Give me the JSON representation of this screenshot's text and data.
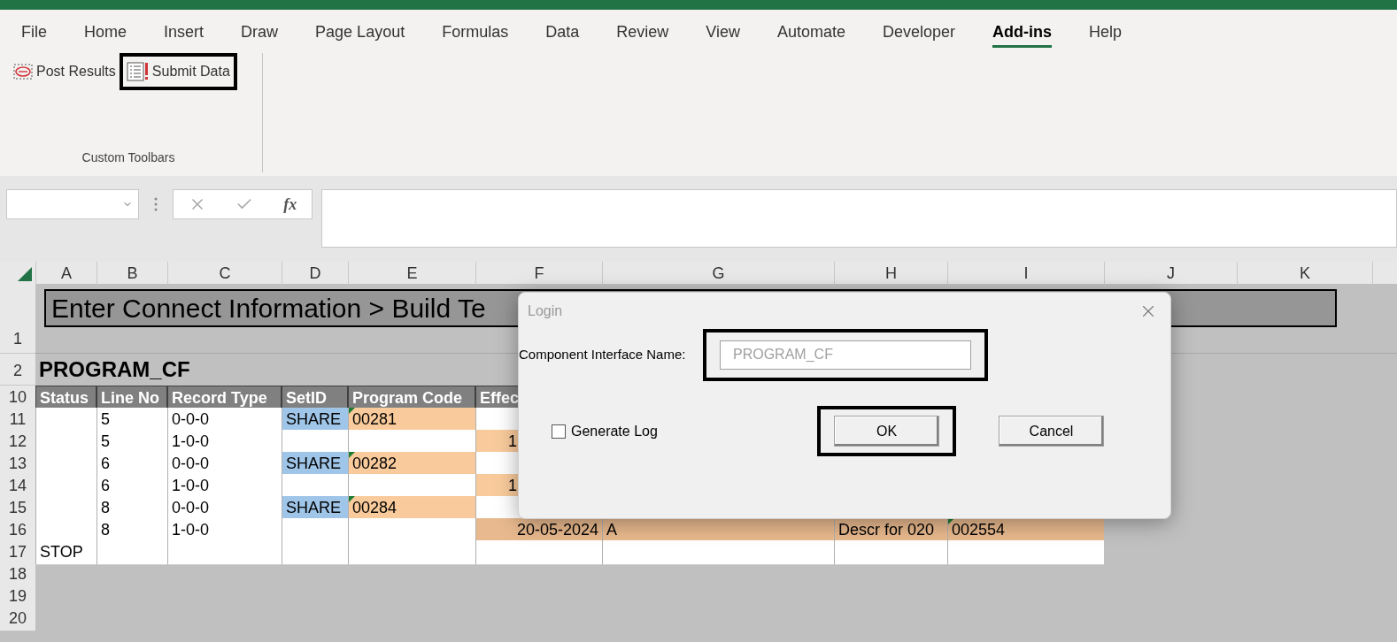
{
  "menu_tabs": [
    {
      "label": "File",
      "selected": false
    },
    {
      "label": "Home",
      "selected": false
    },
    {
      "label": "Insert",
      "selected": false
    },
    {
      "label": "Draw",
      "selected": false
    },
    {
      "label": "Page Layout",
      "selected": false
    },
    {
      "label": "Formulas",
      "selected": false
    },
    {
      "label": "Data",
      "selected": false
    },
    {
      "label": "Review",
      "selected": false
    },
    {
      "label": "View",
      "selected": false
    },
    {
      "label": "Automate",
      "selected": false
    },
    {
      "label": "Developer",
      "selected": false
    },
    {
      "label": "Add-ins",
      "selected": true
    },
    {
      "label": "Help",
      "selected": false
    }
  ],
  "ribbon": {
    "buttons": [
      {
        "label": "Post Results",
        "kind": "post"
      },
      {
        "label": "Submit Data",
        "kind": "submit",
        "highlighted": true
      }
    ],
    "group_label": "Custom Toolbars"
  },
  "formula_bar": {
    "function_button": "fx"
  },
  "sheet": {
    "columns": [
      "A",
      "B",
      "C",
      "D",
      "E",
      "F",
      "G",
      "H",
      "I",
      "J",
      "K"
    ],
    "banner": {
      "row": "1",
      "text": "Enter Connect Information > Build Te"
    },
    "title": {
      "row": "2",
      "text": "PROGRAM_CF"
    },
    "header": {
      "row": "10",
      "cells": [
        "Status",
        "Line No",
        "Record Type",
        "SetID",
        "Program Code",
        "Effec"
      ]
    },
    "rows": [
      {
        "number": "11",
        "divider_below": false,
        "cells": [
          {
            "color": "#ffffff"
          },
          {
            "text": "5",
            "color": "#ffffff"
          },
          {
            "text": "0-0-0",
            "color": "#ffffff"
          },
          {
            "text": "SHARE",
            "color": "#9fc5e8"
          },
          {
            "text": "00281",
            "color": "#f9cb9c",
            "flagged": true
          },
          {
            "color": "#ffffff"
          }
        ]
      },
      {
        "number": "12",
        "divider_below": true,
        "cells": [
          {
            "color": "#ffffff"
          },
          {
            "text": "5",
            "color": "#ffffff"
          },
          {
            "text": "1-0-0",
            "color": "#ffffff"
          },
          {
            "color": "#ffffff"
          },
          {
            "color": "#ffffff"
          },
          {
            "text": "1",
            "color": "#f9cb9c",
            "kind": "clipped"
          }
        ]
      },
      {
        "number": "13",
        "divider_below": false,
        "cells": [
          {
            "color": "#ffffff"
          },
          {
            "text": "6",
            "color": "#ffffff"
          },
          {
            "text": "0-0-0",
            "color": "#ffffff"
          },
          {
            "text": "SHARE",
            "color": "#9fc5e8"
          },
          {
            "text": "00282",
            "color": "#f9cb9c",
            "flagged": true
          },
          {
            "color": "#ffffff"
          }
        ]
      },
      {
        "number": "14",
        "divider_below": true,
        "cells": [
          {
            "color": "#ffffff"
          },
          {
            "text": "6",
            "color": "#ffffff"
          },
          {
            "text": "1-0-0",
            "color": "#ffffff"
          },
          {
            "color": "#ffffff"
          },
          {
            "color": "#ffffff"
          },
          {
            "text": "1",
            "color": "#f9cb9c",
            "kind": "clipped"
          }
        ]
      },
      {
        "number": "15",
        "divider_below": false,
        "cells": [
          {
            "color": "#ffffff"
          },
          {
            "text": "8",
            "color": "#ffffff"
          },
          {
            "text": "0-0-0",
            "color": "#ffffff"
          },
          {
            "text": "SHARE",
            "color": "#9fc5e8"
          },
          {
            "text": "00284",
            "color": "#f9cb9c",
            "flagged": true
          },
          {
            "color": "#ffffff"
          }
        ]
      },
      {
        "number": "16",
        "divider_below": true,
        "cells": [
          {
            "color": "#ffffff"
          },
          {
            "text": "8",
            "color": "#ffffff"
          },
          {
            "text": "1-0-0",
            "color": "#ffffff"
          },
          {
            "color": "#ffffff"
          },
          {
            "color": "#ffffff"
          },
          {
            "text": "20-05-2024",
            "color": "#e8b98e",
            "kind": "right"
          },
          {
            "text": "A",
            "color": "#e8b98e"
          },
          {
            "text": "Descr for 020",
            "color": "#e8b98e"
          },
          {
            "text": "002554",
            "color": "#e8b98e",
            "flagged": true
          }
        ]
      },
      {
        "number": "17",
        "divider_below": false,
        "cells": [
          {
            "text": "STOP",
            "color": "#ffffff"
          },
          {
            "color": "#ffffff"
          },
          {
            "color": "#ffffff"
          },
          {
            "color": "#ffffff"
          },
          {
            "color": "#ffffff"
          },
          {
            "color": "#ffffff"
          },
          {
            "color": "#ffffff"
          },
          {
            "color": "#ffffff"
          },
          {
            "color": "#ffffff"
          }
        ]
      },
      {
        "number": "18",
        "cells": []
      },
      {
        "number": "19",
        "cells": []
      },
      {
        "number": "20",
        "cells": []
      }
    ]
  },
  "dialog": {
    "title": "Login",
    "field_label": "Component Interface Name:",
    "field": {
      "value": "PROGRAM_CF",
      "disabled": true,
      "highlighted": true
    },
    "checkbox": {
      "label": "Generate Log",
      "checked": false
    },
    "buttons": [
      {
        "label": "OK",
        "highlighted": true
      },
      {
        "label": "Cancel"
      }
    ]
  }
}
